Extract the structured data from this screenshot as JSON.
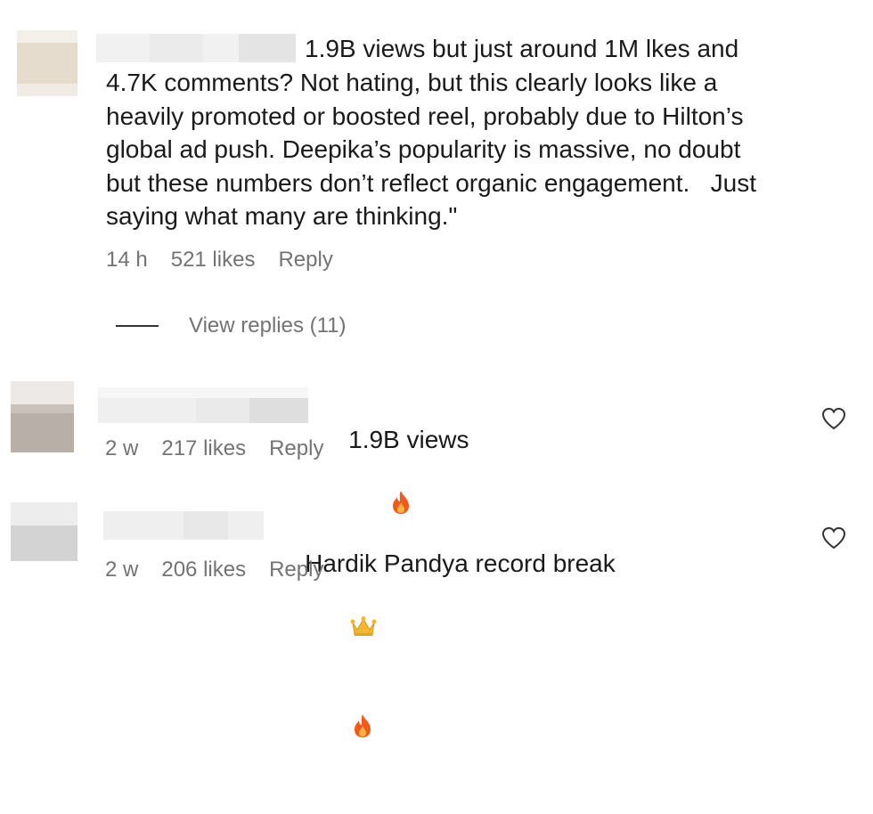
{
  "comments": [
    {
      "text_part1": "1.9B views but just around 1M lkes and",
      "text_lines": [
        "4.7K comments? Not hating, but this clearly looks like a",
        "heavily promoted or boosted reel, probably due to Hilton’s",
        "global ad push. Deepika’s popularity is massive, no doubt",
        "but these numbers don’t reflect organic engagement.   Just",
        "saying what many are thinking.\""
      ],
      "time": "14 h",
      "likes": "521 likes",
      "reply": "Reply",
      "view_replies": "View replies (11)"
    },
    {
      "text": "1.9B views",
      "emoji": [
        "fire-icon"
      ],
      "time": "2 w",
      "likes": "217 likes",
      "reply": "Reply"
    },
    {
      "text": "Hardik Pandya record break",
      "emoji": [
        "crown-icon",
        "fire-icon"
      ],
      "time": "2 w",
      "likes": "206 likes",
      "reply": "Reply"
    }
  ],
  "colors": {
    "text": "#1a1a1a",
    "meta": "#737373",
    "fire": "#f05a1a",
    "crown": "#f2b632"
  }
}
